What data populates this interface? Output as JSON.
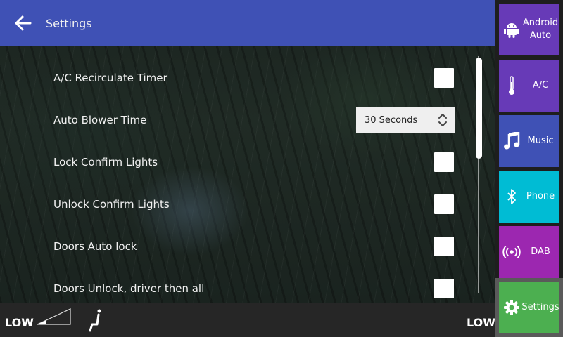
{
  "header": {
    "title": "Settings"
  },
  "settings": [
    {
      "label": "A/C Recirculate Timer",
      "control": "checkbox",
      "checked": false
    },
    {
      "label": "Auto Blower Time",
      "control": "select",
      "value": "30 Seconds"
    },
    {
      "label": "Lock Confirm Lights",
      "control": "checkbox",
      "checked": false
    },
    {
      "label": "Unlock Confirm Lights",
      "control": "checkbox",
      "checked": false
    },
    {
      "label": "Doors Auto lock",
      "control": "checkbox",
      "checked": false
    },
    {
      "label": "Doors Unlock, driver then all",
      "control": "checkbox",
      "checked": false
    }
  ],
  "bottom": {
    "fan_left": "LOW",
    "fan_right": "LOW"
  },
  "nav": [
    {
      "label": "Android Auto",
      "icon": "android-icon",
      "color": "#673ab7"
    },
    {
      "label": "A/C",
      "icon": "thermometer-icon",
      "color": "#673ab7"
    },
    {
      "label": "Music",
      "icon": "music-note-icon",
      "color": "#3f51b5"
    },
    {
      "label": "Phone",
      "icon": "bluetooth-icon",
      "color": "#00bcd4"
    },
    {
      "label": "DAB",
      "icon": "radio-broadcast-icon",
      "color": "#9c27b0"
    },
    {
      "label": "Settings",
      "icon": "gear-icon",
      "color": "#4caf50",
      "active": true
    }
  ]
}
